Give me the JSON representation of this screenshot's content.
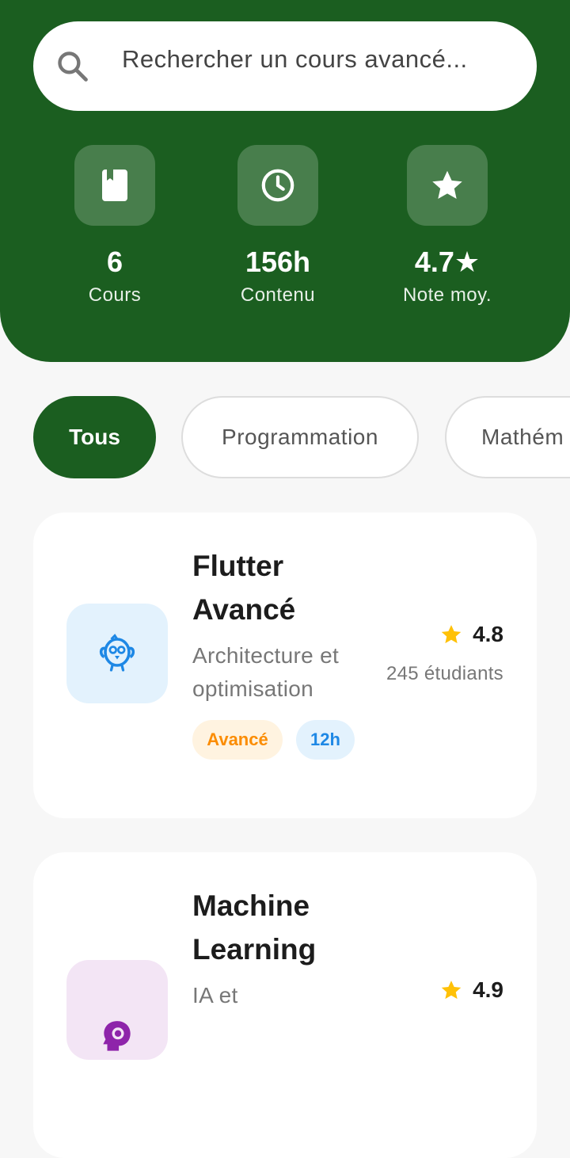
{
  "search": {
    "placeholder": "Rechercher un cours avancé..."
  },
  "stats": [
    {
      "icon": "book-icon",
      "value": "6",
      "label": "Cours"
    },
    {
      "icon": "clock-icon",
      "value": "156h",
      "label": "Contenu"
    },
    {
      "icon": "star-icon",
      "value": "4.7★",
      "label": "Note moy."
    }
  ],
  "filters": [
    {
      "label": "Tous",
      "selected": true
    },
    {
      "label": "Programmation",
      "selected": false
    },
    {
      "label": "Mathém",
      "selected": false
    }
  ],
  "courses": [
    {
      "title": "Flutter Avancé",
      "description": "Architecture et optimisation",
      "level": "Avancé",
      "duration": "12h",
      "rating": "4.8",
      "students": "245 étudiants",
      "icon": "flutter-bird-icon",
      "thumb_color": "#e3f2fd",
      "accent": "#2196f3"
    },
    {
      "title": "Machine Learning",
      "description": "IA et",
      "rating": "4.9",
      "icon": "psychology-icon",
      "thumb_color": "#f3e5f5",
      "accent": "#8e24aa"
    }
  ],
  "colors": {
    "primary": "#1b5e20",
    "star": "#ffc107",
    "level_bg": "#fff3e0",
    "level_text": "#fb8c00",
    "duration_bg": "#e3f2fd",
    "duration_text": "#1e88e5"
  }
}
